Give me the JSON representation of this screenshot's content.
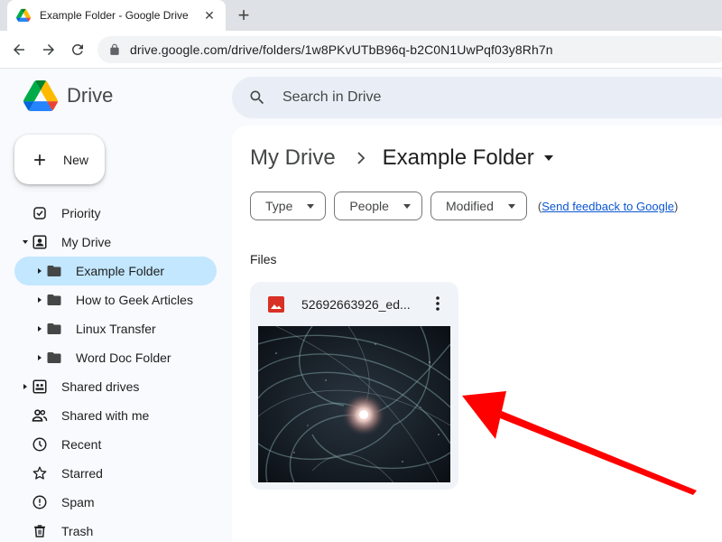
{
  "browser": {
    "tab_title": "Example Folder - Google Drive",
    "close_glyph": "✕",
    "newtab_glyph": "+",
    "url": "drive.google.com/drive/folders/1w8PKvUTbB96q-b2C0N1UwPqf03y8Rh7n"
  },
  "app": {
    "logo_text": "Drive",
    "search_placeholder": "Search in Drive",
    "new_label": "New"
  },
  "sidebar": {
    "items": [
      {
        "label": "Priority",
        "icon": "check-circle-icon"
      },
      {
        "label": "My Drive",
        "icon": "my-drive-icon",
        "expanded": true
      },
      {
        "label": "Example Folder",
        "icon": "folder-icon",
        "selected": true
      },
      {
        "label": "How to Geek Articles",
        "icon": "folder-icon"
      },
      {
        "label": "Linux Transfer",
        "icon": "folder-icon"
      },
      {
        "label": "Word Doc Folder",
        "icon": "folder-icon"
      },
      {
        "label": "Shared drives",
        "icon": "shared-drives-icon"
      },
      {
        "label": "Shared with me",
        "icon": "people-icon"
      },
      {
        "label": "Recent",
        "icon": "clock-icon"
      },
      {
        "label": "Starred",
        "icon": "star-icon"
      },
      {
        "label": "Spam",
        "icon": "spam-icon"
      },
      {
        "label": "Trash",
        "icon": "trash-icon"
      }
    ]
  },
  "main": {
    "breadcrumb": {
      "root": "My Drive",
      "current": "Example Folder"
    },
    "filters": [
      {
        "label": "Type"
      },
      {
        "label": "People"
      },
      {
        "label": "Modified"
      }
    ],
    "feedback": {
      "open": "(",
      "link": "Send feedback to Google",
      "close": ")"
    },
    "section_label": "Files",
    "file": {
      "name": "52692663926_ed...",
      "icon": "image-file-icon"
    }
  },
  "colors": {
    "accent": "#0b57d0",
    "selected_bg": "#c2e7ff",
    "image_icon": "#d93025",
    "arrow": "#ff0000"
  }
}
